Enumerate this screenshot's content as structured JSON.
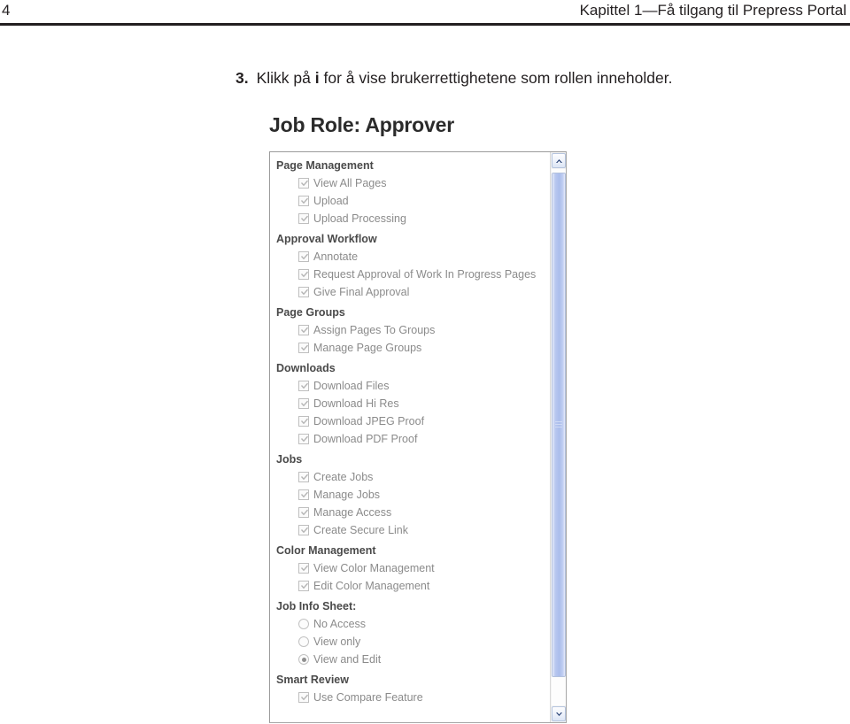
{
  "page": {
    "number": "4",
    "header_title": "Kapittel 1—Få tilgang til Prepress Portal"
  },
  "step": {
    "number": "3.",
    "text_before_emphasis": "Klikk på ",
    "emphasis": "i",
    "text_after_emphasis": " for å vise brukerrettighetene som rollen inneholder."
  },
  "figure": {
    "dialog_title": "Job Role: Approver",
    "groups": [
      {
        "header": "Page Management",
        "control_type": "checkbox",
        "options": [
          {
            "label": "View All Pages",
            "checked": true
          },
          {
            "label": "Upload",
            "checked": true
          },
          {
            "label": "Upload Processing",
            "checked": true
          }
        ]
      },
      {
        "header": "Approval Workflow",
        "control_type": "checkbox",
        "options": [
          {
            "label": "Annotate",
            "checked": true
          },
          {
            "label": "Request Approval of Work In Progress Pages",
            "checked": true
          },
          {
            "label": "Give Final Approval",
            "checked": true
          }
        ]
      },
      {
        "header": "Page Groups",
        "control_type": "checkbox",
        "options": [
          {
            "label": "Assign Pages To Groups",
            "checked": true
          },
          {
            "label": "Manage Page Groups",
            "checked": true
          }
        ]
      },
      {
        "header": "Downloads",
        "control_type": "checkbox",
        "options": [
          {
            "label": "Download Files",
            "checked": true
          },
          {
            "label": "Download Hi Res",
            "checked": true
          },
          {
            "label": "Download JPEG Proof",
            "checked": true
          },
          {
            "label": "Download PDF Proof",
            "checked": true
          }
        ]
      },
      {
        "header": "Jobs",
        "control_type": "checkbox",
        "options": [
          {
            "label": "Create Jobs",
            "checked": true
          },
          {
            "label": "Manage Jobs",
            "checked": true
          },
          {
            "label": "Manage Access",
            "checked": true
          },
          {
            "label": "Create Secure Link",
            "checked": true
          }
        ]
      },
      {
        "header": "Color Management",
        "control_type": "checkbox",
        "options": [
          {
            "label": "View Color Management",
            "checked": true
          },
          {
            "label": "Edit Color Management",
            "checked": true
          }
        ]
      },
      {
        "header": "Job Info Sheet:",
        "control_type": "radio",
        "options": [
          {
            "label": "No Access",
            "checked": false
          },
          {
            "label": "View only",
            "checked": false
          },
          {
            "label": "View and Edit",
            "checked": true
          }
        ]
      },
      {
        "header": "Smart Review",
        "control_type": "checkbox",
        "options": [
          {
            "label": "Use Compare Feature",
            "checked": true
          }
        ]
      }
    ],
    "scrollbar": {
      "up_arrow_icon": "chevron-up-icon",
      "down_arrow_icon": "chevron-down-icon",
      "thumb_grip_icon": "grip-lines-icon",
      "accent_color": "#aabdec"
    }
  },
  "colors": {
    "text": "#231f20",
    "group_header": "#4a4a4a",
    "option_label": "#8b8b8b",
    "listbox_border": "#a6a6a6",
    "scrollbar_accent": "#aabdec"
  }
}
